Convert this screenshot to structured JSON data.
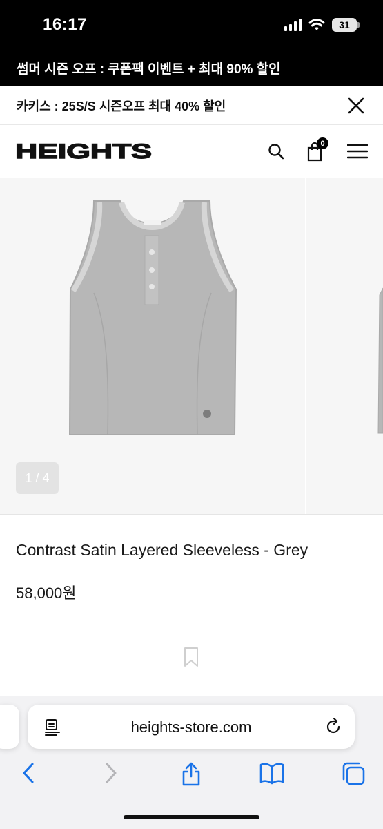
{
  "status_bar": {
    "time": "16:17",
    "battery": "31"
  },
  "promo": {
    "text": "썸머 시즌 오프 : 쿠폰팩 이벤트 + 최대 90% 할인"
  },
  "notice": {
    "text": "카키스 : 25S/S 시즌오프 최대 40% 할인"
  },
  "header": {
    "logo": "HEIGHTS",
    "cart_count": "0"
  },
  "gallery": {
    "indicator": "1 / 4",
    "current_image": 1,
    "total_images": 4
  },
  "product": {
    "name": "Contrast Satin Layered Sleeveless - Grey",
    "price": "58,000원"
  },
  "browser": {
    "url": "heights-store.com"
  },
  "icons": {
    "close": "close-icon",
    "search": "search-icon",
    "cart": "cart-icon",
    "menu": "hamburger-menu-icon",
    "bookmark": "bookmark-icon",
    "reader": "reader-icon",
    "reload": "reload-icon",
    "back": "back-icon",
    "forward": "forward-icon",
    "share": "share-icon",
    "bookmarks": "bookmarks-icon",
    "tabs": "tabs-icon"
  },
  "colors": {
    "accent": "#000000",
    "link_blue": "#1a73e8",
    "image_bg": "#f6f6f6",
    "garment": "#b7b7b7"
  }
}
